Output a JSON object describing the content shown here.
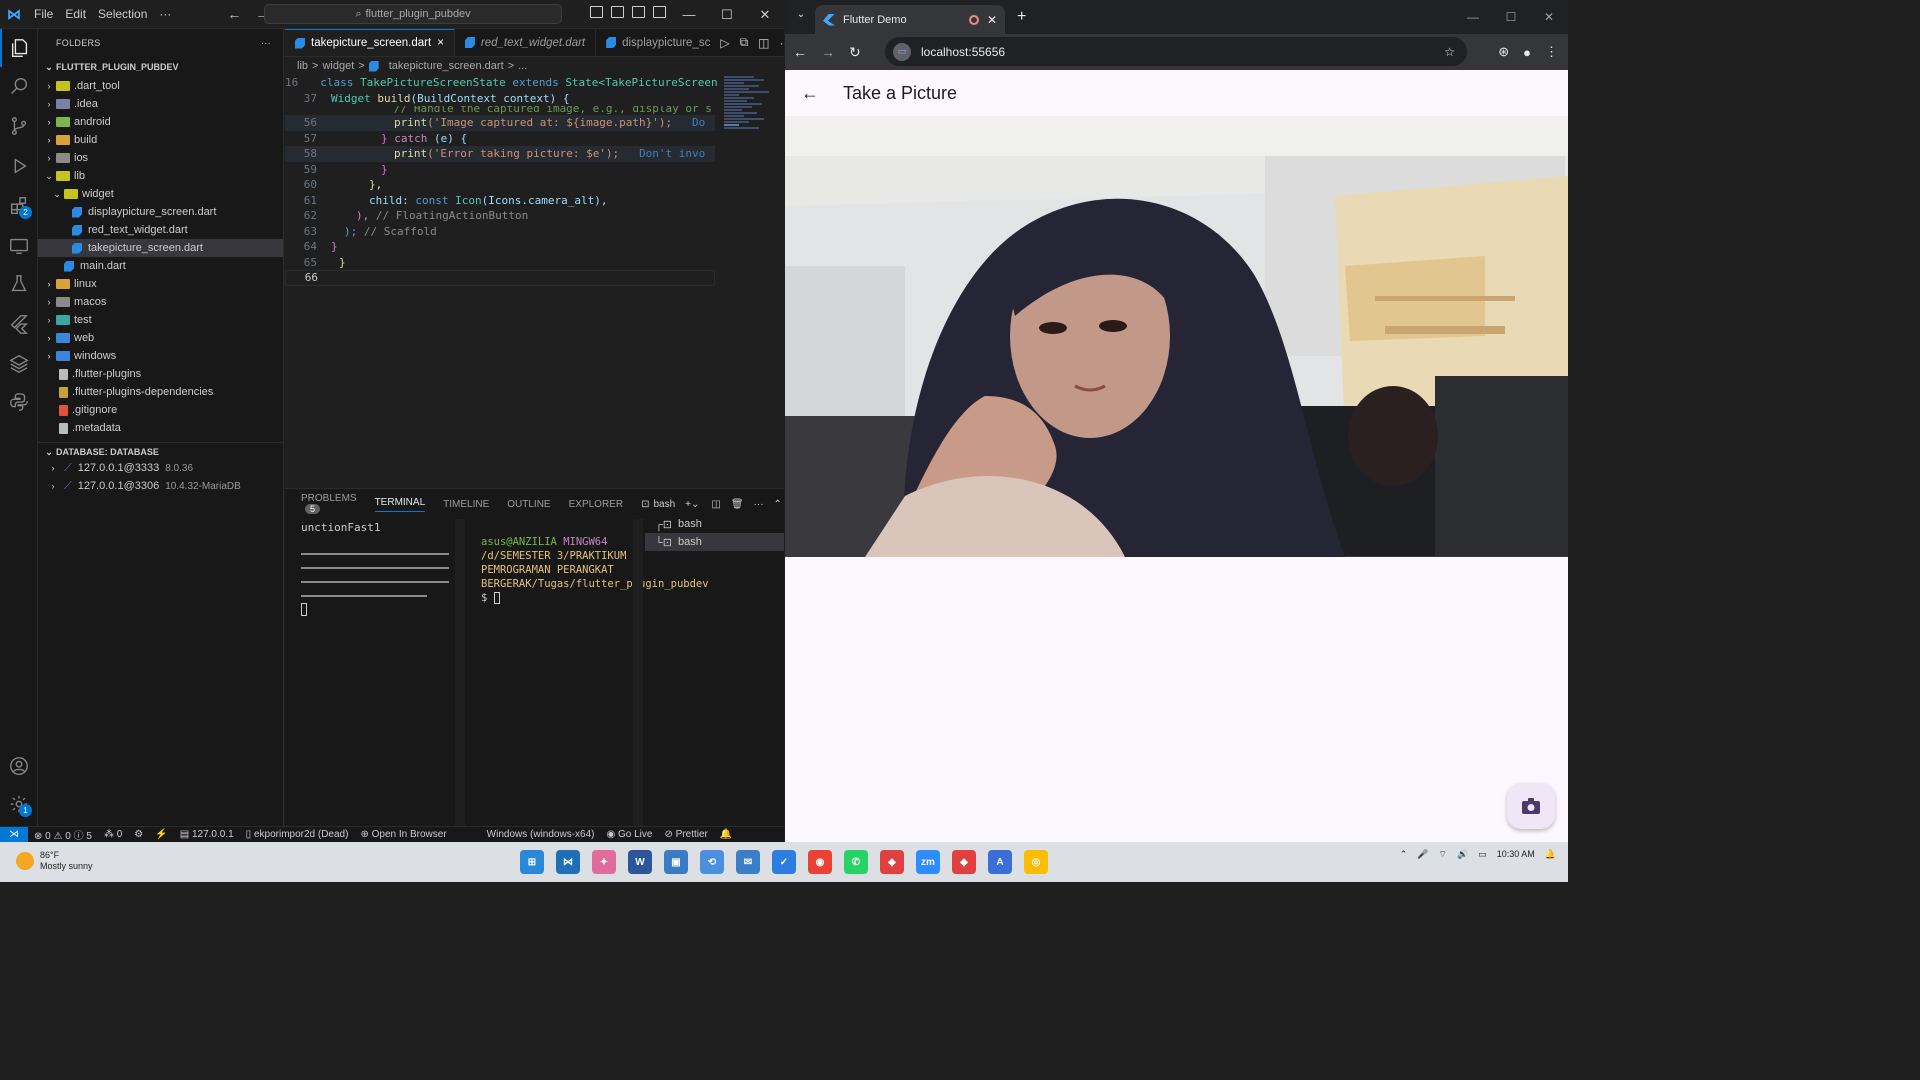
{
  "vscode": {
    "menu": [
      "File",
      "Edit",
      "Selection",
      "···"
    ],
    "command_center": "flutter_plugin_pubdev",
    "activity_badges": {
      "extensions": "2",
      "manage": "1"
    },
    "sidebar": {
      "header": "FOLDERS",
      "project": "FLUTTER_PLUGIN_PUBDEV",
      "tree": [
        {
          "label": ".dart_tool",
          "type": "folder",
          "color": "#c5c31f",
          "indent": 1,
          "chev": "›"
        },
        {
          "label": ".idea",
          "type": "folder",
          "color": "#7c7fa8",
          "indent": 1,
          "chev": "›"
        },
        {
          "label": "android",
          "type": "folder",
          "color": "#7ab648",
          "indent": 1,
          "chev": "›"
        },
        {
          "label": "build",
          "type": "folder",
          "color": "#d8a13a",
          "indent": 1,
          "chev": "›"
        },
        {
          "label": "ios",
          "type": "folder",
          "color": "#8a8a8a",
          "indent": 1,
          "chev": "›"
        },
        {
          "label": "lib",
          "type": "folder",
          "color": "#c5c31f",
          "indent": 1,
          "chev": "⌄"
        },
        {
          "label": "widget",
          "type": "folder",
          "color": "#c5c31f",
          "indent": 2,
          "chev": "⌄"
        },
        {
          "label": "displaypicture_screen.dart",
          "type": "dart",
          "indent": 3,
          "chev": ""
        },
        {
          "label": "red_text_widget.dart",
          "type": "dart",
          "indent": 3,
          "chev": ""
        },
        {
          "label": "takepicture_screen.dart",
          "type": "dart",
          "indent": 3,
          "chev": "",
          "selected": true
        },
        {
          "label": "main.dart",
          "type": "dart",
          "indent": 2,
          "chev": ""
        },
        {
          "label": "linux",
          "type": "folder",
          "color": "#d8a13a",
          "indent": 1,
          "chev": "›"
        },
        {
          "label": "macos",
          "type": "folder",
          "color": "#8a8a8a",
          "indent": 1,
          "chev": "›"
        },
        {
          "label": "test",
          "type": "folder",
          "color": "#3aa7a1",
          "indent": 1,
          "chev": "›"
        },
        {
          "label": "web",
          "type": "folder",
          "color": "#3a85d8",
          "indent": 1,
          "chev": "›"
        },
        {
          "label": "windows",
          "type": "folder",
          "color": "#3a85d8",
          "indent": 1,
          "chev": "›"
        },
        {
          "label": ".flutter-plugins",
          "type": "file",
          "color": "#bbbbbb",
          "indent": 1,
          "chev": ""
        },
        {
          "label": ".flutter-plugins-dependencies",
          "type": "file",
          "color": "#c8a13a",
          "indent": 1,
          "chev": ""
        },
        {
          "label": ".gitignore",
          "type": "file",
          "color": "#e0533a",
          "indent": 1,
          "chev": ""
        },
        {
          "label": ".metadata",
          "type": "file",
          "color": "#bbbbbb",
          "indent": 1,
          "chev": ""
        }
      ],
      "database_header": "DATABASE: DATABASE",
      "connections": [
        {
          "host": "127.0.0.1@3333",
          "version": "8.0.36"
        },
        {
          "host": "127.0.0.1@3306",
          "version": "10.4.32-MariaDB"
        }
      ]
    },
    "tabs": [
      {
        "label": "takepicture_screen.dart",
        "active": true,
        "close": "×"
      },
      {
        "label": "red_text_widget.dart",
        "active": false,
        "italic": true
      },
      {
        "label": "displaypicture_sc",
        "active": false
      }
    ],
    "breadcrumb": [
      "lib",
      ">",
      "widget",
      ">",
      "takepicture_screen.dart",
      ">",
      "..."
    ],
    "code": {
      "l16": "16",
      "l37": "37",
      "l56": "56",
      "l57": "57",
      "l58": "58",
      "l59": "59",
      "l60": "60",
      "l61": "61",
      "l62": "62",
      "l63": "63",
      "l64": "64",
      "l65": "65",
      "l66": "66",
      "c16_kw": "class",
      "c16_cls": "TakePictureScreenState",
      "c16_ext": "extends",
      "c16_state": "State<TakePictureScreen",
      "c37_cls": "Widget",
      "c37_fn": "build",
      "c37_ctx": "(BuildContext context) {",
      "c55_cmt": "// Handle the captured image, e.g., display or s",
      "c56_fn": "print",
      "c56_str": "('Image captured at: ${image.path}');",
      "c56_hint": "Do",
      "c57_a": "} ",
      "c57_kw": "catch",
      "c57_b": " (e) {",
      "c58_fn": "print",
      "c58_str": "('Error taking picture: $e');",
      "c58_hint": "Don't invo",
      "c59": "}",
      "c60": "},",
      "c61_var": "child",
      "c61_kw": "const",
      "c61_cls": "Icon",
      "c61_rest": "(Icons.camera_alt),",
      "c62_a": "),",
      "c62_cmt": "// FloatingActionButton",
      "c63_a": ");",
      "c63_cmt": "// Scaffold",
      "c64": "}",
      "c65": "}"
    },
    "panel": {
      "tabs": [
        "PROBLEMS",
        "TERMINAL",
        "TIMELINE",
        "OUTLINE",
        "EXPLORER"
      ],
      "problems_count": "5",
      "terminal_name": "bash",
      "left_output": "unctionFast1",
      "prompt_user": "asus@ANZILIA",
      "prompt_shell": "MINGW64",
      "prompt_path": "/d/SEMESTER 3/PRAKTIKUM PEMROGRAMAN PERANGKAT BERGERAK/Tugas/flutter_plugin_pubdev",
      "prompt_symbol": "$",
      "terminals": [
        "bash",
        "bash"
      ]
    },
    "status": {
      "errors": "0",
      "warnings": "0",
      "infos": "5",
      "ports": "0",
      "db": "127.0.0.1",
      "db_name": "ekporimpor2d (Dead)",
      "open_browser": "Open In Browser",
      "device": "Windows (windows-x64)",
      "go_live": "Go Live",
      "prettier": "Prettier"
    }
  },
  "chrome": {
    "tab_title": "Flutter Demo",
    "url": "localhost:55656",
    "app_title": "Take a Picture"
  },
  "taskbar": {
    "temperature": "86°F",
    "condition": "Mostly sunny",
    "time": "10:30 AM"
  }
}
